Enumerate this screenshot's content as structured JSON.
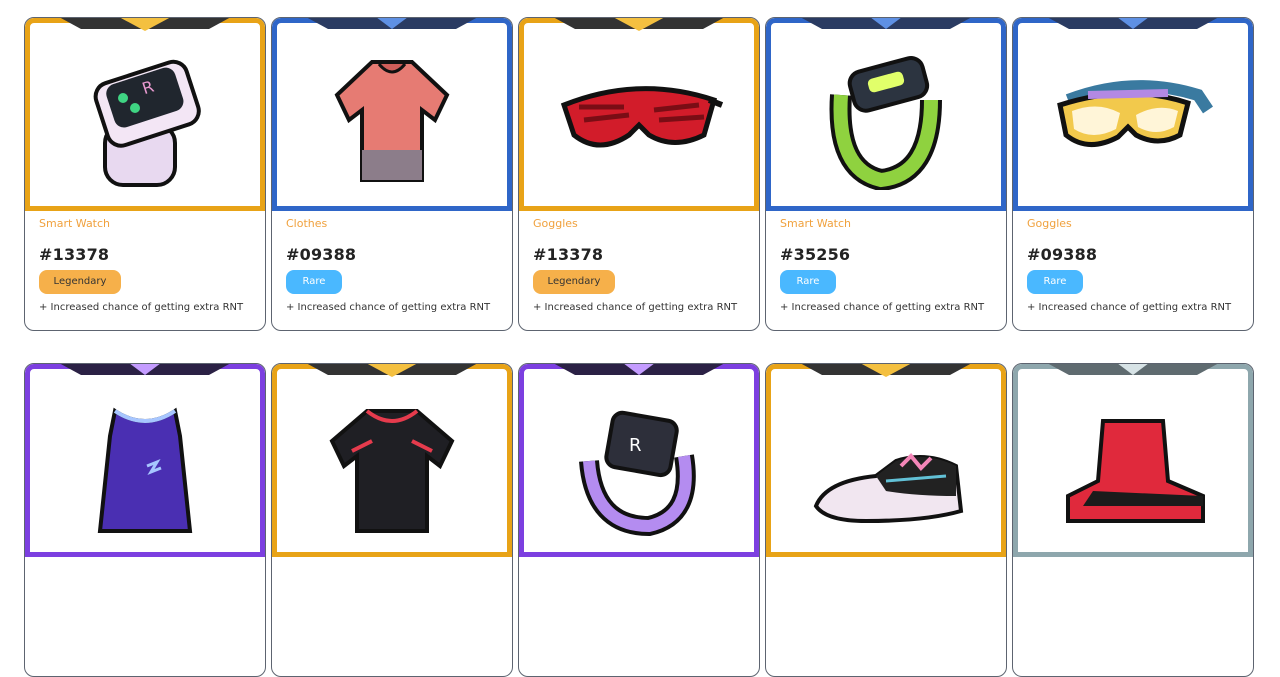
{
  "cards": [
    {
      "type": "Smart Watch",
      "id": "#13378",
      "rarity": "Legendary",
      "rarity_class": "legendary",
      "desc": "+ Increased chance of getting extra RNT",
      "icon": "smart-watch-icon"
    },
    {
      "type": "Clothes",
      "id": "#09388",
      "rarity": "Rare",
      "rarity_class": "rare",
      "desc": "+ Increased chance of getting extra RNT",
      "icon": "shirt-icon"
    },
    {
      "type": "Goggles",
      "id": "#13378",
      "rarity": "Legendary",
      "rarity_class": "legendary",
      "desc": "+ Increased chance of getting extra RNT",
      "icon": "goggles-icon"
    },
    {
      "type": "Smart Watch",
      "id": "#35256",
      "rarity": "Rare",
      "rarity_class": "rare",
      "desc": "+ Increased chance of getting extra RNT",
      "icon": "fitness-band-icon"
    },
    {
      "type": "Goggles",
      "id": "#09388",
      "rarity": "Rare",
      "rarity_class": "rare",
      "desc": "+ Increased chance of getting extra RNT",
      "icon": "goggles-icon"
    },
    {
      "icon": "tank-top-icon",
      "frame_class": "epic"
    },
    {
      "icon": "jersey-icon",
      "frame_class": "legendary"
    },
    {
      "icon": "smart-watch-icon",
      "frame_class": "epic"
    },
    {
      "icon": "sneaker-icon",
      "frame_class": "legendary"
    },
    {
      "icon": "high-top-shoe-icon",
      "frame_class": "common"
    }
  ],
  "colors": {
    "legendary": "#f6b04a",
    "rare": "#4ab8ff",
    "type_text": "#f0a13d"
  }
}
